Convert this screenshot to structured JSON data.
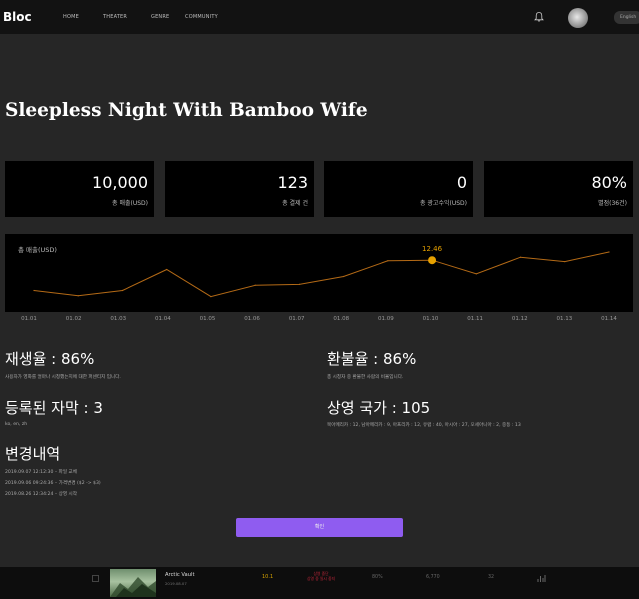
{
  "app": {
    "logo": "Bloc",
    "nav": [
      "HOME",
      "THEATER",
      "GENRE",
      "COMMUNITY"
    ],
    "lang": "English"
  },
  "page": {
    "title": "Sleepless Night With Bamboo Wife"
  },
  "stats": [
    {
      "value": "10,000",
      "label": "총 매출(USD)"
    },
    {
      "value": "123",
      "label": "총 결제 건"
    },
    {
      "value": "0",
      "label": "총 광고수익(USD)"
    },
    {
      "value": "80%",
      "label": "별점(36건)"
    }
  ],
  "chart_data": {
    "type": "line",
    "title": "총 매출(USD)",
    "categories": [
      "01.01",
      "01.02",
      "01.03",
      "01.04",
      "01.05",
      "01.06",
      "01.07",
      "01.08",
      "01.09",
      "01.10",
      "01.11",
      "01.12",
      "01.13",
      "01.14"
    ],
    "values": [
      9,
      8.4,
      9,
      11.4,
      8.3,
      9.6,
      9.7,
      10.6,
      12.4,
      12.46,
      10.9,
      12.8,
      12.3,
      13.4
    ],
    "highlight": {
      "category": "01.10",
      "label": "12.46",
      "color": "#e6a100"
    },
    "line_color": "#b46a16",
    "ylim": [
      7,
      15
    ],
    "grid": false
  },
  "sections": {
    "replay": {
      "heading": "재생율 : 86%",
      "desc": "사용자가 영화를 얼마나 시청했는지에 대한 퍼센티지 입니다."
    },
    "refund": {
      "heading": "환불율 : 86%",
      "desc": "총 시청자 중 환불한 사람의 비율입니다."
    },
    "subtitles": {
      "heading": "등록된 자막 : 3",
      "desc": "ko, en, zh"
    },
    "countries": {
      "heading": "상영 국가 : 105",
      "desc": "북아메리카 : 12, 남아메리카 : 9, 아프리카 : 12, 유럽 : 40, 아시아 : 27, 오세아니아 : 2, 중동 : 13"
    },
    "history": {
      "heading": "변경내역",
      "items": [
        "2019.09.07 12:12:30 – 파일 교체",
        "2019.09.06 09:24:36 – 가격변경 ($2 -> $3)",
        "2019.08.26 12:34:24 – 상영 시작"
      ]
    }
  },
  "actions": {
    "confirm": "확인"
  },
  "player": {
    "title": "Arctic Vault",
    "subtitle": "2019.08.07",
    "rating": "10.1",
    "status_line1": "상영 중단",
    "status_line2": "상영 중 일시 중지",
    "percent": "80%",
    "count": "6,770",
    "views": "32"
  }
}
